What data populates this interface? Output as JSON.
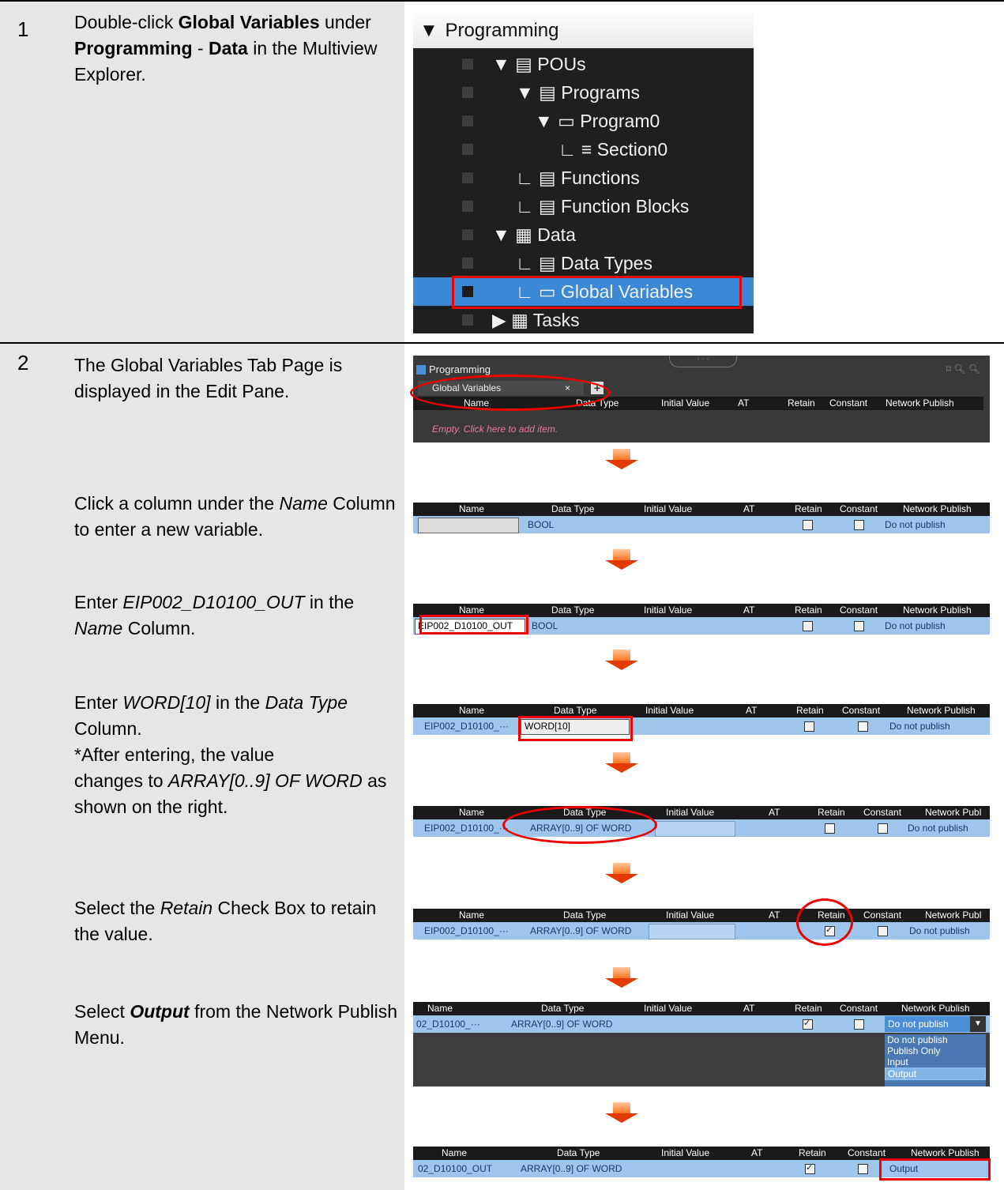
{
  "step1": {
    "number": "1",
    "text": {
      "a": "Double-click ",
      "b": "Global Variables",
      "c": " under ",
      "d": "Programming",
      "e": " - ",
      "f": "Data",
      "g": " in the Multiview Explorer."
    },
    "tree": {
      "header": "Programming",
      "items": [
        "POUs",
        "Programs",
        "Program0",
        "Section0",
        "Functions",
        "Function Blocks",
        "Data",
        "Data Types",
        "Global Variables",
        "Tasks"
      ]
    }
  },
  "step2": {
    "number": "2",
    "p1": "The Global Variables Tab Page is displayed in the Edit Pane.",
    "p2": {
      "a": "Click a column under the ",
      "b": "Name",
      "c": " Column to enter a new variable."
    },
    "p3": {
      "a": "Enter ",
      "b": "EIP002_D10100_OUT",
      "c": " in the ",
      "d": "Name",
      "e": " Column."
    },
    "p4": {
      "a": "Enter ",
      "b": "WORD[10]",
      "c": " in the ",
      "d": "Data Type",
      "e": " Column.",
      "f": "*After entering, the value",
      "g": " changes to ",
      "h": "ARRAY[0..9] OF WORD",
      "i": " as shown on the right."
    },
    "p5": {
      "a": "Select the ",
      "b": "Retain",
      "c": " Check Box to retain the value."
    },
    "p6": {
      "a": "Select ",
      "b": "Output",
      "c": " from the Network Publish Menu."
    },
    "pane1": {
      "title": "Programming",
      "tab": "Global Variables",
      "tab_close": "×",
      "tab_add": "+",
      "empty_hint": "Empty. Click here to add item."
    },
    "columns": {
      "name": "Name",
      "type": "Data Type",
      "type_cut": "Data Type",
      "init": "Initial Value",
      "at": "AT",
      "retain": "Retain",
      "constant": "Constant",
      "publish": "Network Publish",
      "publish_cut": "Network Publ",
      "publish_cut2": "Network Publish",
      "constant_cut": "Constant"
    },
    "rows": {
      "r1": {
        "type": "BOOL",
        "publish": "Do not publish"
      },
      "r2": {
        "name": "EIP002_D10100_OUT",
        "type": "BOOL",
        "publish": "Do not publish"
      },
      "r3": {
        "name": "EIP002_D10100_···",
        "type": "WORD[10]",
        "publish": "Do not publish"
      },
      "r4": {
        "name": "EIP002_D10100_···",
        "type": "ARRAY[0..9] OF WORD",
        "publish": "Do not publish"
      },
      "r5": {
        "name": "EIP002_D10100_···",
        "type": "ARRAY[0..9] OF WORD",
        "publish": "Do not publish"
      },
      "r6": {
        "name": "02_D10100_···",
        "type": "ARRAY[0..9] OF WORD",
        "publish": "Do not publish",
        "options": [
          "Do not publish",
          "Publish Only",
          "Input",
          "Output"
        ]
      },
      "r7": {
        "name": "02_D10100_OUT",
        "type": "ARRAY[0..9] OF WORD",
        "publish": "Output"
      }
    }
  }
}
